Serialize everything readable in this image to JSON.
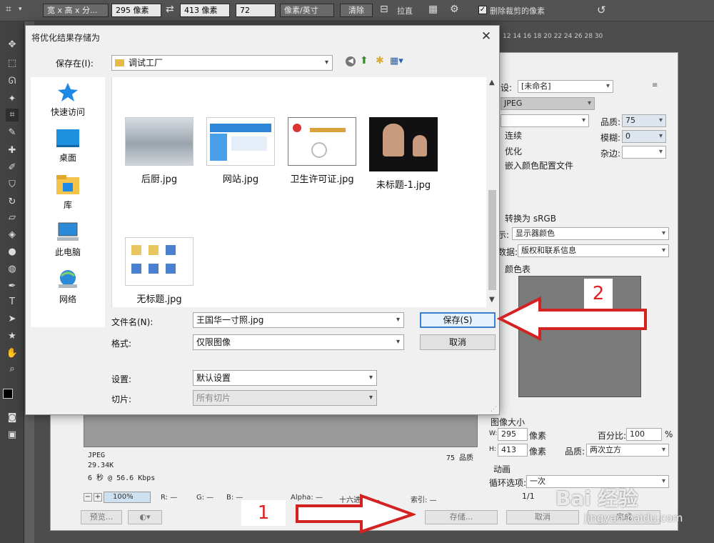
{
  "optbar": {
    "ratio": "宽 x 高 x 分...",
    "width": "295 像素",
    "height": "413 像素",
    "resolution": "72",
    "res_unit": "像素/英寸",
    "clear": "清除",
    "straighten": "拉直",
    "delete_cropped": "删除裁剪的像素"
  },
  "sfw": {
    "ruler": "12 14 16 18 20 22 24 26 28 30",
    "preset_label": "设:",
    "preset_value": "[未命名]",
    "format_value": "JPEG",
    "quality_label": "品质:",
    "quality_value": "75",
    "blur_label": "模糊:",
    "blur_value": "0",
    "matte_label": "杂边:",
    "progressive": "连续",
    "optimized": "优化",
    "embed_profile": "嵌入颜色配置文件",
    "convert_srgb": "转换为 sRGB",
    "preview_label": "示:",
    "preview_value": "显示器颜色",
    "metadata_label": "数据:",
    "metadata_value": "版权和联系信息",
    "color_table_label": "颜色表",
    "image_size_label": "图像大小",
    "w_label": "W:",
    "w_value": "295",
    "h_label": "H:",
    "h_value": "413",
    "px": "像素",
    "percent_label": "百分比:",
    "percent_value": "100",
    "percent_sign": "%",
    "quality2_label": "品质:",
    "quality2_value": "两次立方",
    "animation_label": "动画",
    "loop_label": "循环选项:",
    "loop_value": "一次",
    "frame": "1/1",
    "info_format": "JPEG",
    "info_size": "29.34K",
    "info_time": "6 秒 @ 56.6 Kbps",
    "info_quality": "75 品质",
    "zoom": "100%",
    "r": "R: —",
    "g": "G: —",
    "b": "B: —",
    "alpha": "Alpha: —",
    "hex": "十六进制: —",
    "index": "索引: —",
    "preview_btn": "预览...",
    "save_btn": "存储...",
    "cancel_btn": "取消",
    "done_btn": "完成"
  },
  "dialog": {
    "title": "将优化结果存储为",
    "save_in_label": "保存在(I):",
    "save_in_value": "调试工厂",
    "places": [
      {
        "label": "快速访问"
      },
      {
        "label": "桌面"
      },
      {
        "label": "库"
      },
      {
        "label": "此电脑"
      },
      {
        "label": "网络"
      }
    ],
    "files": [
      {
        "name": "后厨.jpg"
      },
      {
        "name": "网站.jpg"
      },
      {
        "name": "卫生许可证.jpg"
      },
      {
        "name": "未标题-1.jpg"
      },
      {
        "name": "无标题.jpg"
      }
    ],
    "filename_label": "文件名(N):",
    "filename_value": "王国华一寸照.jpg",
    "format_label": "格式:",
    "format_value": "仅限图像",
    "settings_label": "设置:",
    "settings_value": "默认设置",
    "slices_label": "切片:",
    "slices_value": "所有切片",
    "save_button": "保存(S)",
    "cancel_button": "取消"
  },
  "annotations": {
    "step1": "1",
    "step2": "2",
    "watermark": "Bai 经验",
    "watermark_url": "jingyan.baidu.com"
  },
  "colors": {
    "accent": "#3c7fd1",
    "arrow": "#d22222",
    "ps_bg": "#535353"
  }
}
